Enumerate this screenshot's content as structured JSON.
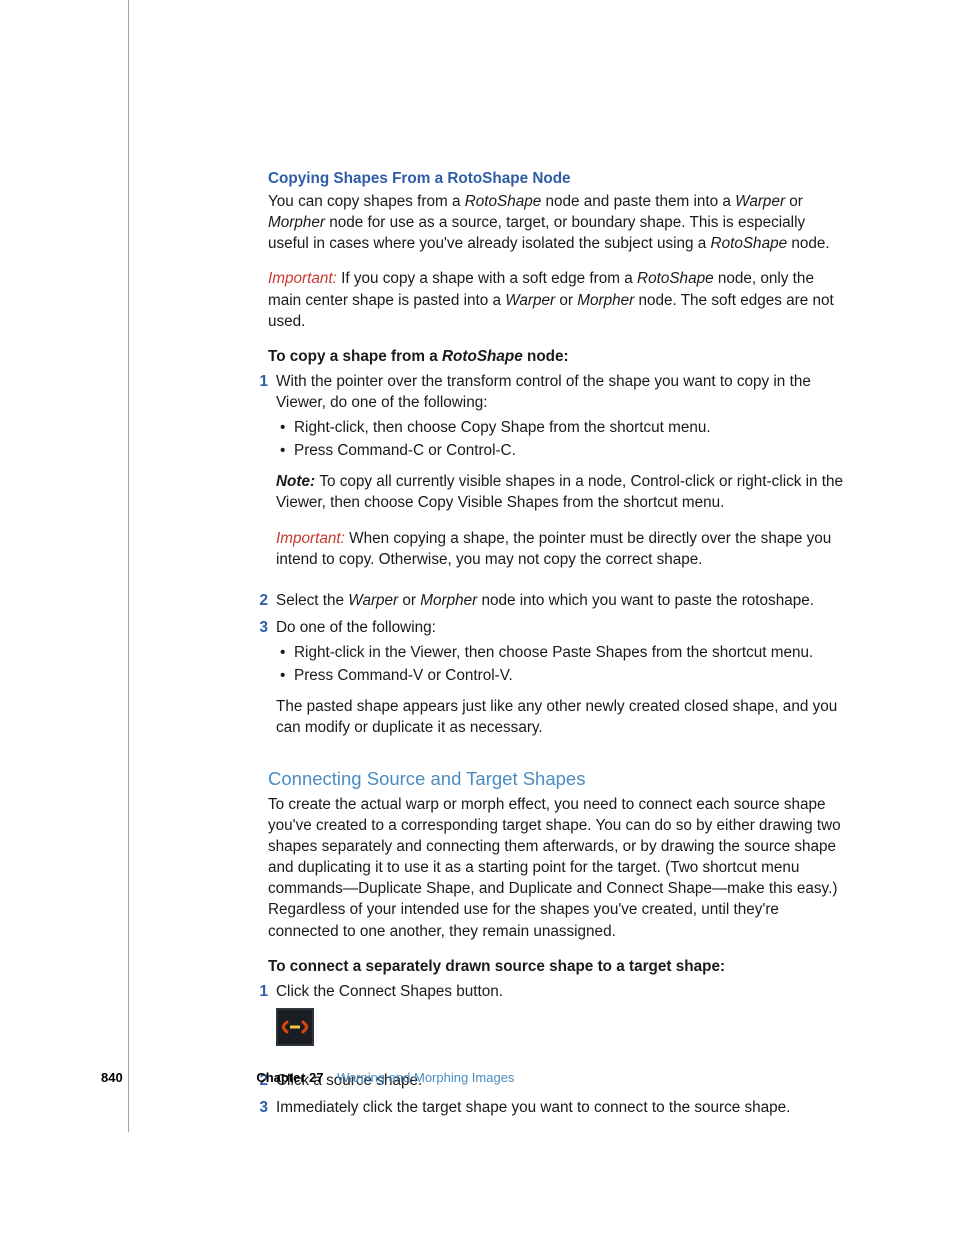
{
  "section1": {
    "heading": "Copying Shapes From a RotoShape Node",
    "p1_a": "You can copy shapes from a ",
    "p1_i1": "RotoShape",
    "p1_b": " node and paste them into a ",
    "p1_i2": "Warper",
    "p1_c": " or ",
    "p1_i3": "Morpher",
    "p1_d": " node for use as a source, target, or boundary shape. This is especially useful in cases where you've already isolated the subject using a ",
    "p1_i4": "RotoShape",
    "p1_e": " node.",
    "imp_label": "Important:  ",
    "p2_a": "If you copy a shape with a soft edge from a ",
    "p2_i1": "RotoShape",
    "p2_b": " node, only the main center shape is pasted into a ",
    "p2_i2": "Warper",
    "p2_c": " or ",
    "p2_i3": "Morpher",
    "p2_d": " node. The soft edges are not used.",
    "proc_a": "To copy a shape from a ",
    "proc_i": "RotoShape",
    "proc_b": " node:",
    "step1": "With the pointer over the transform control of the shape you want to copy in the Viewer, do one of the following:",
    "s1_b1": "Right-click, then choose Copy Shape from the shortcut menu.",
    "s1_b2": "Press Command-C or Control-C.",
    "note_label": "Note:  ",
    "note": "To copy all currently visible shapes in a node, Control-click or right-click in the Viewer, then choose Copy Visible Shapes from the shortcut menu.",
    "imp2": "When copying a shape, the pointer must be directly over the shape you intend to copy. Otherwise, you may not copy the correct shape.",
    "step2_a": "Select the ",
    "step2_i1": "Warper",
    "step2_b": " or ",
    "step2_i2": "Morpher",
    "step2_c": " node into which you want to paste the rotoshape.",
    "step3": "Do one of the following:",
    "s3_b1": "Right-click in the Viewer, then choose Paste Shapes from the shortcut menu.",
    "s3_b2": "Press Command-V or Control-V.",
    "trail": "The pasted shape appears just like any other newly created closed shape, and you can modify or duplicate it as necessary."
  },
  "section2": {
    "heading": "Connecting Source and Target Shapes",
    "intro": "To create the actual warp or morph effect, you need to connect each source shape you've created to a corresponding target shape. You can do so by either drawing two shapes separately and connecting them afterwards, or by drawing the source shape and duplicating it to use it as a starting point for the target. (Two shortcut menu commands—Duplicate Shape, and Duplicate and Connect Shape—make this easy.) Regardless of your intended use for the shapes you've created, until they're connected to one another, they remain unassigned.",
    "proc": "To connect a separately drawn source shape to a target shape:",
    "step1": "Click the Connect Shapes button.",
    "step2": "Click a source shape.",
    "step3": "Immediately click the target shape you want to connect to the source shape."
  },
  "footer": {
    "page": "840",
    "chapter_label": "Chapter 27",
    "chapter_title": "Warping and Morphing Images"
  },
  "nums": {
    "n1": "1",
    "n2": "2",
    "n3": "3"
  }
}
